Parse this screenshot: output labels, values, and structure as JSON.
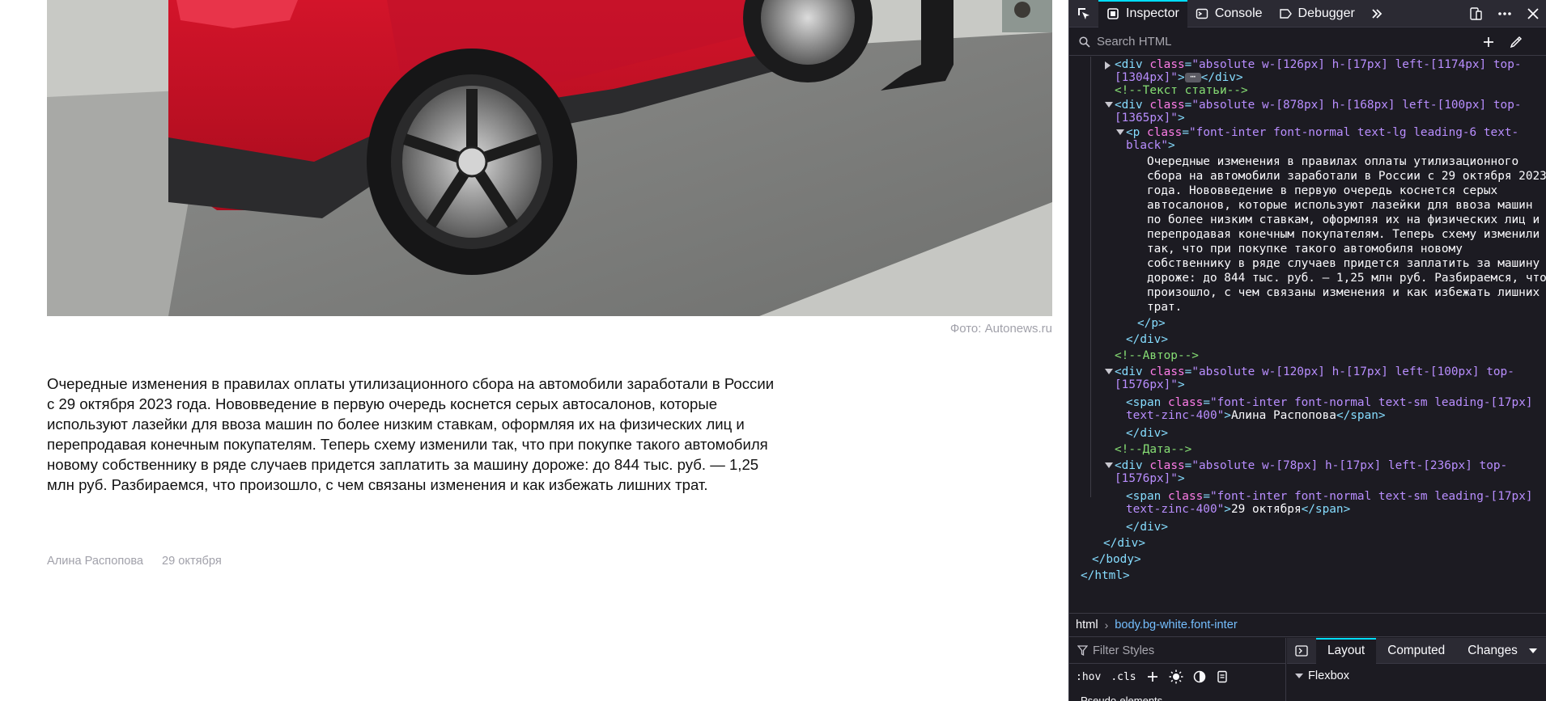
{
  "page": {
    "photo_credit": "Фото: Autonews.ru",
    "article_text": "Очередные изменения в правилах оплаты утилизационного сбора на автомобили заработали в России с 29 октября 2023 года. Нововведение в первую очередь коснется серых автосалонов, которые используют лазейки для ввоза машин по более низким ставкам, оформляя их на физических лиц и перепродавая конечным покупателям. Теперь схему изменили так, что при покупке такого автомобиля новому собственнику в ряде случаев придется заплатить за машину дороже: до 844 тыс. руб. — 1,25 млн руб. Разбираемся, что произошло, с чем связаны изменения и как избежать лишних трат.",
    "author": "Алина Распопова",
    "date": "29 октября"
  },
  "devtools": {
    "tabs": {
      "inspector": "Inspector",
      "console": "Console",
      "debugger": "Debugger"
    },
    "search_placeholder": "Search HTML",
    "markup": {
      "l01_a": "<div ",
      "l01_b": "class",
      "l01_c": "=",
      "l01_d": "\"absolute w-[126px] h-[17px] left-[1174px] top-",
      "l02_a": "[1304px]\"",
      "l02_b": ">",
      "l02_c": "</div>",
      "l03": "<!--Текст статьи-->",
      "l04_a": "<div ",
      "l04_b": "class",
      "l04_c": "=",
      "l04_d": "\"absolute w-[878px] h-[168px] left-[100px] top-",
      "l05_a": "[1365px]\"",
      "l05_b": ">",
      "l06_a": "<p ",
      "l06_b": "class",
      "l06_c": "=",
      "l06_d": "\"font-inter font-normal text-lg leading-6 text-",
      "l07_a": "black\"",
      "l07_b": ">",
      "t01": "Очередные изменения в правилах оплаты утилизационного",
      "t02": "сбора на автомобили заработали в России с 29 октября 2023",
      "t03": "года. Нововведение в первую очередь коснется серых",
      "t04": "автосалонов, которые используют лазейки для ввоза машин",
      "t05": "по более низким ставкам, оформляя их на физических лиц и",
      "t06": "перепродавая конечным покупателям. Теперь схему изменили",
      "t07": "так, что при покупке такого автомобиля новому",
      "t08": "собственнику в ряде случаев придется заплатить за машину",
      "t09": "дороже: до 844 тыс. руб. — 1,25 млн руб. Разбираемся, что",
      "t10": "произошло, с чем связаны изменения и как избежать лишних",
      "t11": "трат.",
      "l19": "</p>",
      "l20": "</div>",
      "l21": "<!--Автор-->",
      "l22_a": "<div ",
      "l22_b": "class",
      "l22_c": "=",
      "l22_d": "\"absolute w-[120px] h-[17px] left-[100px] top-",
      "l23_a": "[1576px]\"",
      "l23_b": ">",
      "l24_a": "<span ",
      "l24_b": "class",
      "l24_c": "=",
      "l24_d": "\"font-inter font-normal text-sm leading-[17px]",
      "l25_a": "text-zinc-400\"",
      "l25_b": ">",
      "l25_c": "Алина Распопова",
      "l25_d": "</span>",
      "l25_e": ">",
      "l26": "</div>",
      "l27": "<!--Дата-->",
      "l28_a": "<div ",
      "l28_b": "class",
      "l28_c": "=",
      "l28_d": "\"absolute w-[78px] h-[17px] left-[236px] top-",
      "l29_a": "[1576px]\"",
      "l29_b": ">",
      "l30_a": "<span ",
      "l30_b": "class",
      "l30_c": "=",
      "l30_d": "\"font-inter font-normal text-sm leading-[17px]",
      "l31_a": "text-zinc-400\"",
      "l31_b": ">",
      "l31_c": "29 октября",
      "l31_d": "</span>",
      "l31_e": ">",
      "l32": "</div>",
      "l33": "</div>",
      "l34": "</body>",
      "l35": "</html>"
    },
    "breadcrumbs": [
      "html",
      "body.bg-white.font-inter"
    ],
    "filter_styles_placeholder": "Filter Styles",
    "rules_tools": {
      "hov": ":hov",
      "cls": ".cls"
    },
    "pseudo_label": "Pseudo-elements",
    "layout_tabs": {
      "layout": "Layout",
      "computed": "Computed",
      "changes": "Changes"
    },
    "flexbox_label": "Flexbox"
  }
}
